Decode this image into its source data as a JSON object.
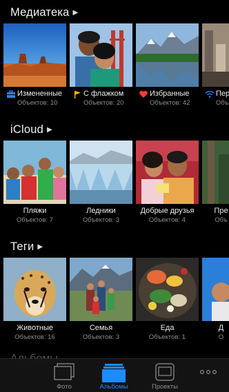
{
  "sections": [
    {
      "title": "Медиатека",
      "albums": [
        {
          "label": "Измененные",
          "count": "Объектов: 10",
          "icon": "toolbox-icon",
          "icon_color": "#2a7fff"
        },
        {
          "label": "С флажком",
          "count": "Объектов: 20",
          "icon": "flag-icon",
          "icon_color": "#f2b705"
        },
        {
          "label": "Избранные",
          "count": "Объектов: 42",
          "icon": "heart-icon",
          "icon_color": "#ff3b30"
        },
        {
          "label": "Пер",
          "count": "Объ",
          "icon": "wifi-icon",
          "icon_color": "#2a7fff"
        }
      ]
    },
    {
      "title": "iCloud",
      "albums": [
        {
          "label": "Пляжи",
          "count": "Объектов: 7"
        },
        {
          "label": "Ледники",
          "count": "Объектов: 3"
        },
        {
          "label": "Добрые друзья",
          "count": "Объектов: 4"
        },
        {
          "label": "Пре",
          "count": "Объ"
        }
      ]
    },
    {
      "title": "Теги",
      "albums": [
        {
          "label": "Животные",
          "count": "Объектов: 16"
        },
        {
          "label": "Семья",
          "count": "Объектов: 3"
        },
        {
          "label": "Еда",
          "count": "Объектов: 1"
        },
        {
          "label": "Д",
          "count": "О"
        }
      ]
    }
  ],
  "next_section_peek": "Альбомы",
  "tabbar": {
    "tabs": [
      {
        "label": "Фото",
        "icon": "photos-icon",
        "active": false
      },
      {
        "label": "Альбомы",
        "icon": "albums-icon",
        "active": true
      },
      {
        "label": "Проекты",
        "icon": "projects-icon",
        "active": false
      },
      {
        "label": "",
        "icon": "more-icon",
        "active": false
      }
    ]
  },
  "colors": {
    "background": "#000000",
    "accent": "#1a8cff",
    "count_text": "#8e8e8e"
  }
}
